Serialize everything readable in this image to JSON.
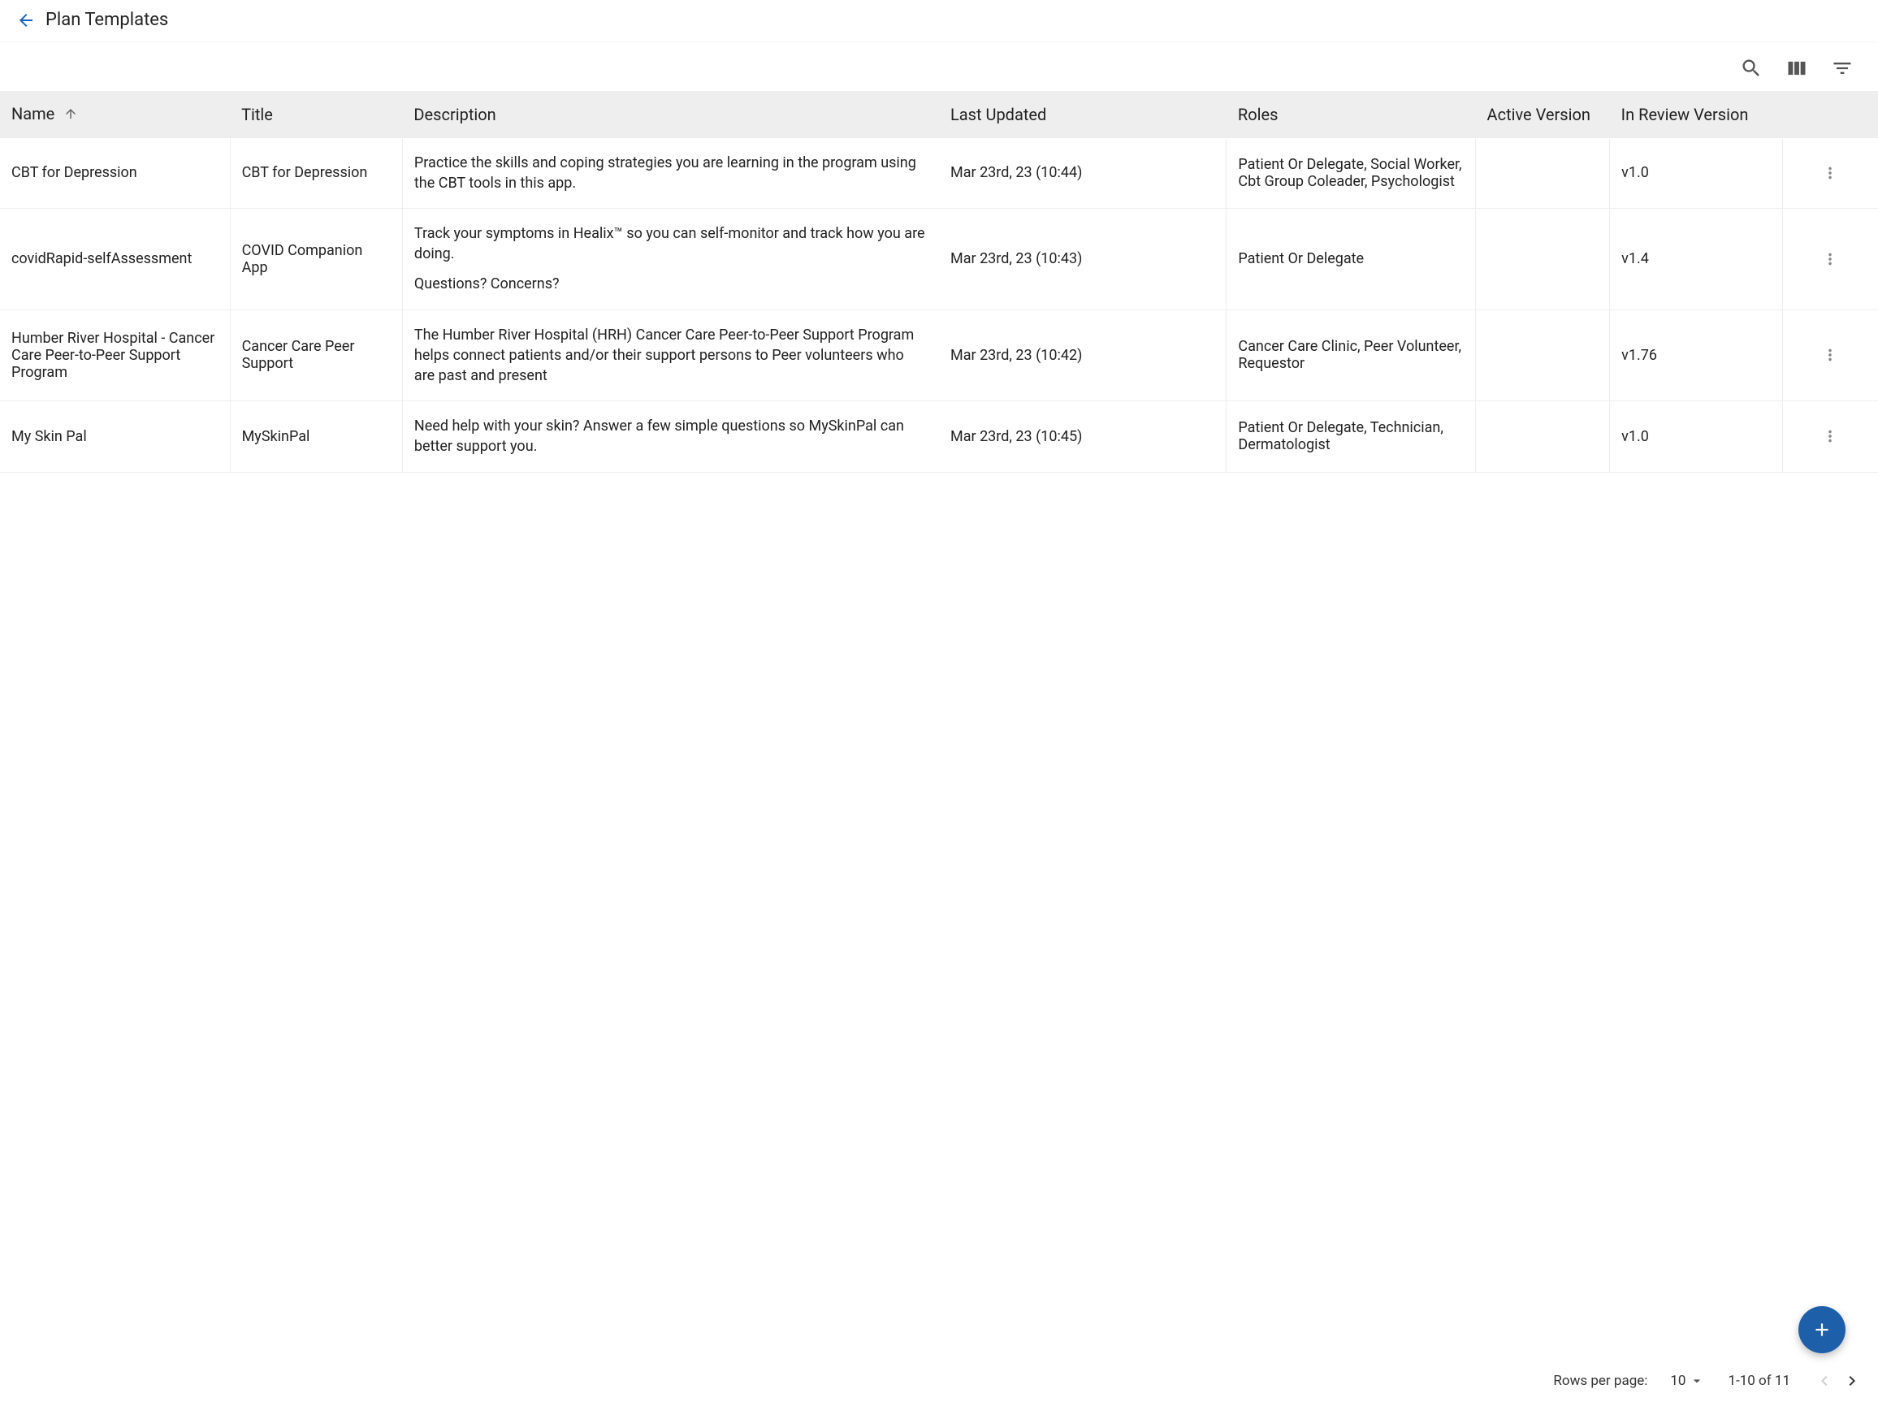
{
  "header": {
    "title": "Plan Templates"
  },
  "columns": {
    "name": "Name",
    "title": "Title",
    "description": "Description",
    "lastUpdated": "Last Updated",
    "roles": "Roles",
    "activeVersion": "Active Version",
    "inReviewVersion": "In Review Version"
  },
  "rows": [
    {
      "name": "CBT for Depression",
      "title": "CBT for Depression",
      "description": "Practice the skills and coping strategies you are learning in the program using the CBT tools in this app.",
      "lastUpdated": "Mar 23rd, 23 (10:44)",
      "roles": "Patient Or Delegate, Social Worker, Cbt Group Coleader, Psychologist",
      "activeVersion": "",
      "inReviewVersion": "v1.0"
    },
    {
      "name": "covidRapid-selfAssessment",
      "title": "COVID Companion App",
      "descriptionLine1": "Track your symptoms in Healix™ so you can self-monitor and track how you are doing.",
      "descriptionLine2": "Questions? Concerns?",
      "lastUpdated": "Mar 23rd, 23 (10:43)",
      "roles": "Patient Or Delegate",
      "activeVersion": "",
      "inReviewVersion": "v1.4"
    },
    {
      "name": "Humber River Hospital - Cancer Care Peer-to-Peer Support Program",
      "title": "Cancer Care Peer Support",
      "description": "The Humber River Hospital (HRH) Cancer Care Peer-to-Peer Support Program helps connect patients and/or their support persons to Peer volunteers who are past and present",
      "lastUpdated": "Mar 23rd, 23 (10:42)",
      "roles": "Cancer Care Clinic, Peer Volunteer, Requestor",
      "activeVersion": "",
      "inReviewVersion": "v1.76"
    },
    {
      "name": "My Skin Pal",
      "title": "MySkinPal",
      "description": "Need help with your skin? Answer a few simple questions so MySkinPal can better support you.",
      "lastUpdated": "Mar 23rd, 23 (10:45)",
      "roles": "Patient Or Delegate, Technician, Dermatologist",
      "activeVersion": "",
      "inReviewVersion": "v1.0"
    }
  ],
  "pagination": {
    "rowsPerPageLabel": "Rows per page:",
    "rowsPerPage": "10",
    "pageInfo": "1-10 of 11"
  }
}
